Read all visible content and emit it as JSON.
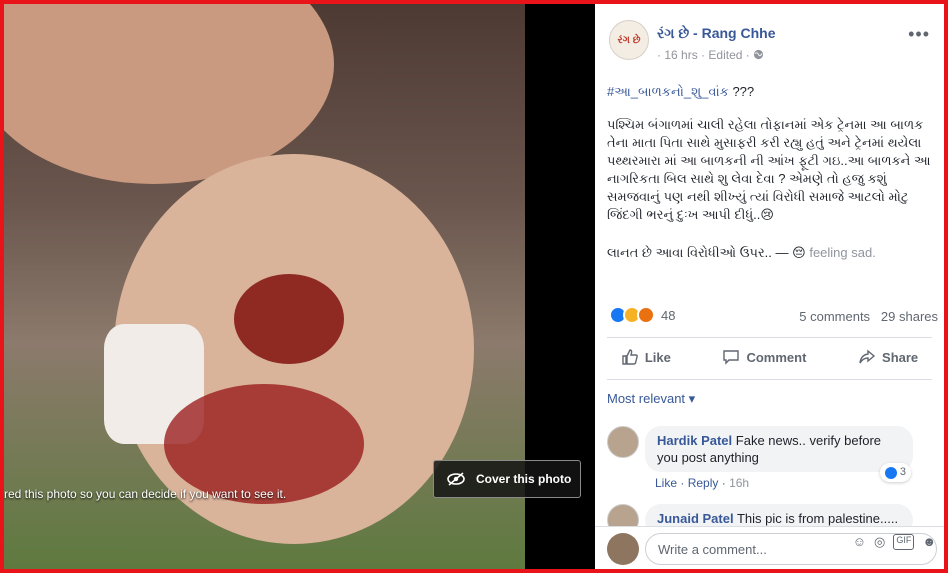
{
  "photo": {
    "sensitive_notice": "red this photo so you can decide if you want to see it.",
    "cover_button_label": "Cover this photo"
  },
  "post": {
    "page_name": "રંગ છે - Rang Chhe",
    "avatar_text": "રંગ છે",
    "time": "16 hrs",
    "edited": "Edited",
    "separator": "·",
    "hashtag": "#આ_બાળકનો_શુ_વાંક",
    "hashtag_suffix": " ???",
    "body": "પશ્ચિમ બંગાળમાં ચાલી રહેલા તોફાનમાં એક ટ્રેનમા આ બાળક તેના માતા પિતા સાથે મુસાફરી કરી રહ્યુ હતું અને ટ્રેનમાં થયેલા પથ્થરમારા માં આ બાળકની ની આંખ ફૂટી ગઇ..આ બાળકને આ નાગરિકતા બિલ સાથે શુ લેવા દેવા ? એમણે તો હજુ કશું સમજવાનું પણ નથી શીખ્યું ત્યાં વિરોધી સમાજે આટલો મોટુ જિંદગી ભરનું દુઃખ આપી દીધું..😢",
    "closing_line": "લાનત છે આવા વિરોધીઓ ઉપર.. — ",
    "feeling_emoji": "😔",
    "feeling_text": "feeling sad.",
    "reaction_count": "48",
    "comments_count": "5 comments",
    "shares_count": "29 shares"
  },
  "actions": {
    "like": "Like",
    "comment": "Comment",
    "share": "Share"
  },
  "comments": {
    "sort_label": "Most relevant",
    "items": [
      {
        "author": "Hardik Patel",
        "text": "Fake news.. verify before you post anything",
        "likes": "3",
        "like_label": "Like",
        "reply_label": "Reply",
        "time": "16h"
      },
      {
        "author": "Junaid Patel",
        "text": "This pic is from palestine....."
      }
    ],
    "composer_placeholder": "Write a comment...",
    "gif_label": "GIF"
  },
  "colors": {
    "brand_link": "#385898",
    "frame_red": "#e8141a"
  }
}
